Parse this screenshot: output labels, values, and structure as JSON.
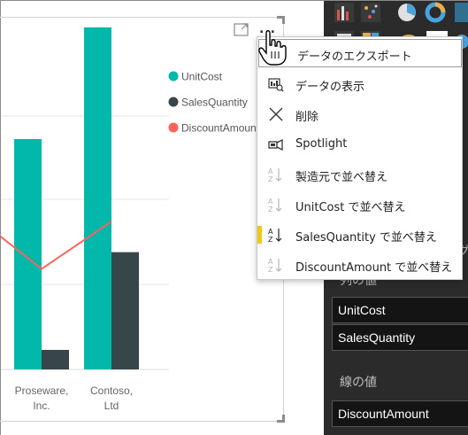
{
  "canvas": {
    "header_icons": [
      "focus-mode-icon",
      "more-options-icon"
    ],
    "more_label": "..."
  },
  "legend": [
    {
      "label": "UnitCost",
      "color": "#01b8aa"
    },
    {
      "label": "SalesQuantity",
      "color": "#374649"
    },
    {
      "label": "DiscountAmount",
      "color": "#fd625e"
    }
  ],
  "chart_data": {
    "type": "bar",
    "categories": [
      "",
      "Proseware,\nInc.",
      "Contoso,\nLtd"
    ],
    "x_tick_labels": [
      [
        "Proseware,",
        "Inc."
      ],
      [
        "Contoso,",
        "Ltd"
      ]
    ],
    "series": [
      {
        "name": "UnitCost",
        "type": "bar",
        "color": "#01b8aa",
        "values": [
          null,
          165,
          245
        ]
      },
      {
        "name": "SalesQuantity",
        "type": "bar",
        "color": "#374649",
        "values": [
          null,
          14,
          84
        ]
      },
      {
        "name": "DiscountAmount",
        "type": "line",
        "color": "#fd625e",
        "values": [
          100,
          72,
          106
        ]
      }
    ],
    "ylim": [
      0,
      250
    ],
    "grid": true,
    "legend_position": "top-right"
  },
  "menu": {
    "items": [
      {
        "label": "データのエクスポート",
        "icon": "export-data-icon",
        "hovered": true
      },
      {
        "label": "データの表示",
        "icon": "see-data-icon"
      },
      {
        "label": "削除",
        "icon": "remove-icon"
      },
      {
        "label": "Spotlight",
        "icon": "spotlight-icon"
      },
      {
        "label": "製造元で並べ替え",
        "icon": "sort-az-icon"
      },
      {
        "label": "UnitCost で並べ替え",
        "icon": "sort-az-icon"
      },
      {
        "label": "SalesQuantity で並べ替え",
        "icon": "sort-az-icon",
        "active": true
      },
      {
        "label": "DiscountAmount で並べ替え",
        "icon": "sort-az-icon"
      }
    ],
    "active_indicator_color": "#f2c811"
  },
  "pane": {
    "icons": [
      "ribbon-chart-icon",
      "scatter-chart-icon",
      "pie-chart-icon",
      "donut-chart-icon",
      "map-icon",
      "funnel-icon",
      "treemap-icon",
      "card-icon"
    ],
    "card_icon_text": "123",
    "partial_label_fragment": "グ",
    "column_values_label": "列の値",
    "column_values": [
      "UnitCost",
      "SalesQuantity"
    ],
    "line_values_label": "線の値",
    "line_values": [
      "DiscountAmount"
    ]
  }
}
